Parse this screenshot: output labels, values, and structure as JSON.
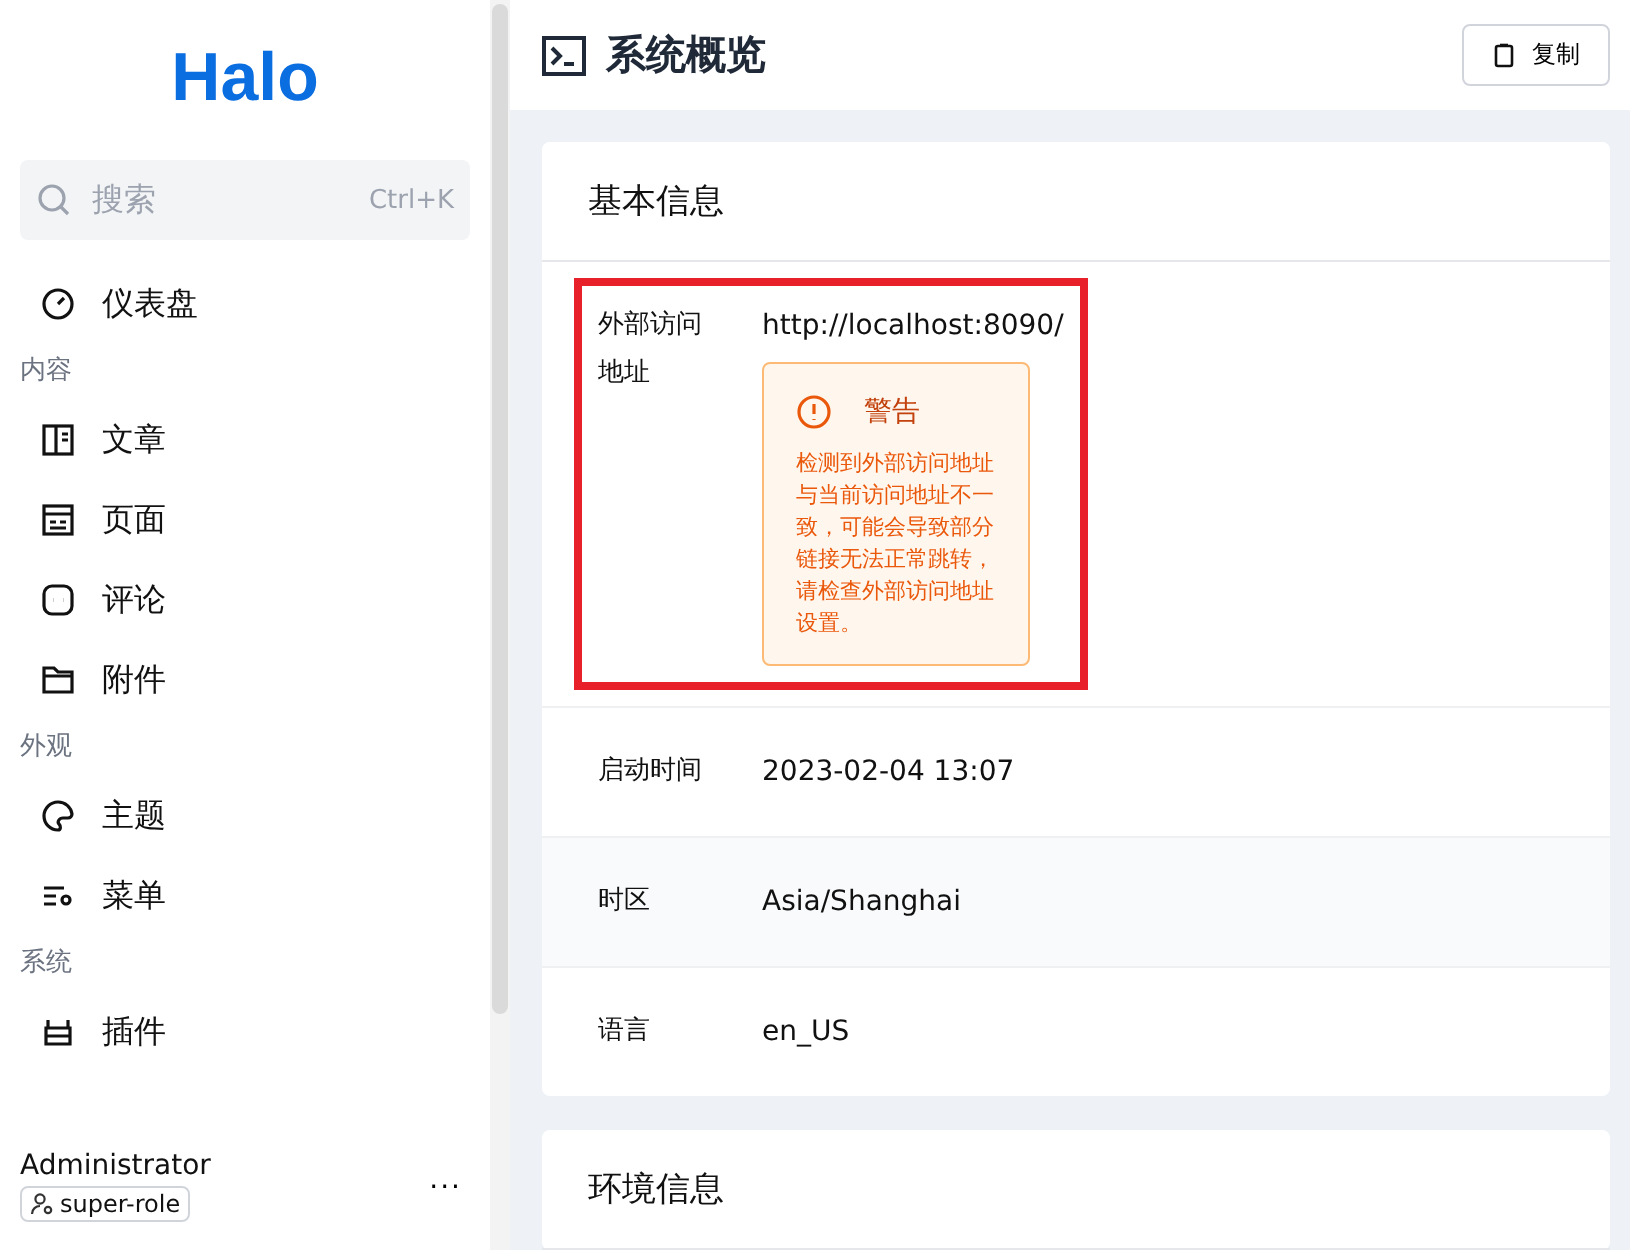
{
  "sidebar": {
    "logo": "Halo",
    "search": {
      "placeholder": "搜索",
      "shortcut": "Ctrl+K"
    },
    "groups": [
      {
        "items": [
          {
            "label": "仪表盘"
          }
        ]
      },
      {
        "title": "内容",
        "items": [
          {
            "label": "文章"
          },
          {
            "label": "页面"
          },
          {
            "label": "评论"
          },
          {
            "label": "附件"
          }
        ]
      },
      {
        "title": "外观",
        "items": [
          {
            "label": "主题"
          },
          {
            "label": "菜单"
          }
        ]
      },
      {
        "title": "系统",
        "items": [
          {
            "label": "插件"
          }
        ]
      }
    ],
    "user": {
      "name": "Administrator",
      "role": "super-role",
      "menu": "..."
    }
  },
  "header": {
    "title": "系统概览",
    "copy_button": "复制"
  },
  "cards": [
    {
      "title": "基本信息",
      "rows": [
        {
          "label": "外部访问地址",
          "value": "http://localhost:8090/",
          "highlighted": true,
          "alert": {
            "title": "警告",
            "text": "检测到外部访问地址与当前访问地址不一致，可能会导致部分链接无法正常跳转，请检查外部访问地址设置。"
          }
        },
        {
          "label": "启动时间",
          "value": "2023-02-04 13:07",
          "highlighted": false
        },
        {
          "label": "时区",
          "value": "Asia/Shanghai",
          "highlighted": false
        },
        {
          "label": "语言",
          "value": "en_US",
          "highlighted": false
        }
      ]
    },
    {
      "title": "环境信息"
    }
  ]
}
